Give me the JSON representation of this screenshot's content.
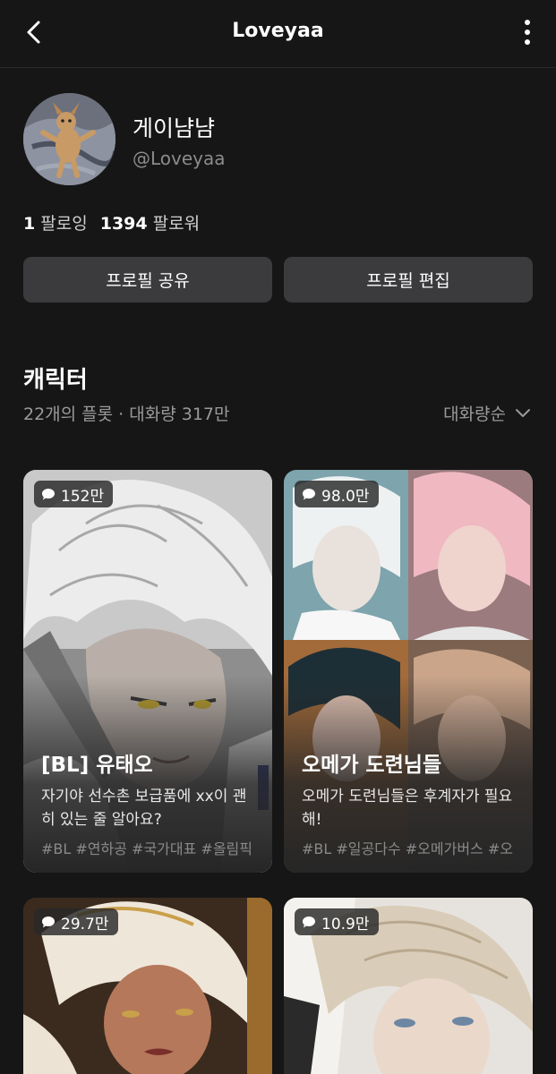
{
  "header": {
    "title": "Loveyaa"
  },
  "profile": {
    "name": "게이냠냠",
    "handle": "@Loveyaa",
    "following_count": "1",
    "following_label": "팔로잉",
    "followers_count": "1394",
    "followers_label": "팔로워"
  },
  "buttons": {
    "share": "프로필 공유",
    "edit": "프로필 편집"
  },
  "section": {
    "title": "캐릭터",
    "meta": "22개의 플롯 · 대화량 317만",
    "sort_label": "대화량순"
  },
  "cards": [
    {
      "count": "152만",
      "title": "[BL] 유태오",
      "desc": "자기야 선수촌 보급품에 xx이 괜히 있는 줄 알아요?",
      "tags": "#BL #연하공 #국가대표 #올림픽"
    },
    {
      "count": "98.0만",
      "title": "오메가 도련님들",
      "desc": "오메가 도련님들은 후계자가 필요해!",
      "tags": "#BL #일공다수 #오메가버스 #오"
    },
    {
      "count": "29.7만"
    },
    {
      "count": "10.9만"
    }
  ],
  "icons": {
    "back": "chevron-left-icon",
    "more": "more-vertical-icon",
    "sort": "chevron-down-icon",
    "chat": "chat-bubble-icon"
  },
  "colors": {
    "background": "#161616",
    "button": "#3b3b3d",
    "card": "#262626",
    "muted": "#9a9a9a"
  }
}
